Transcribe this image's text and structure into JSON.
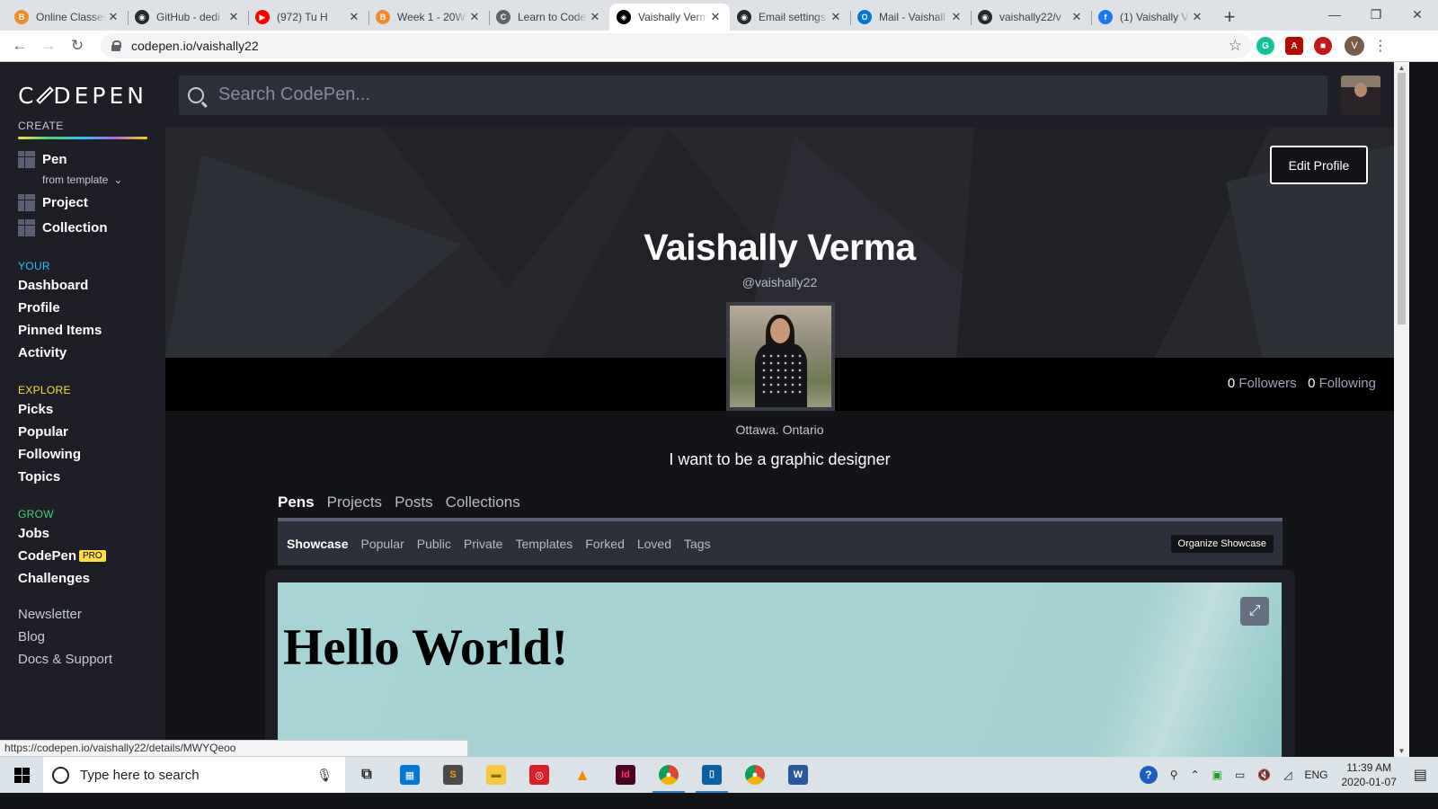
{
  "browser": {
    "tabs": [
      {
        "title": "Online Classes",
        "icon_color": "#f28c28",
        "icon_glyph": "B",
        "active": false
      },
      {
        "title": "GitHub - dedi",
        "icon_color": "#24292e",
        "icon_glyph": "◉",
        "active": false
      },
      {
        "title": "(972) Tu H",
        "icon_color": "#ff0000",
        "icon_glyph": "▶",
        "active": false
      },
      {
        "title": "Week 1 - 20W",
        "icon_color": "#f28c28",
        "icon_glyph": "B",
        "active": false
      },
      {
        "title": "Learn to Code",
        "icon_color": "#5f6368",
        "icon_glyph": "C",
        "active": false
      },
      {
        "title": "Vaishally Verm",
        "icon_color": "#000000",
        "icon_glyph": "◈",
        "active": true
      },
      {
        "title": "Email settings",
        "icon_color": "#24292e",
        "icon_glyph": "◉",
        "active": false
      },
      {
        "title": "Mail - Vaishall",
        "icon_color": "#0078d4",
        "icon_glyph": "O",
        "active": false
      },
      {
        "title": "vaishally22/v",
        "icon_color": "#24292e",
        "icon_glyph": "◉",
        "active": false
      },
      {
        "title": "(1) Vaishally V",
        "icon_color": "#1877f2",
        "icon_glyph": "f",
        "active": false
      }
    ],
    "url": "codepen.io/vaishally22",
    "profile_initial": "V",
    "status_url": "https://codepen.io/vaishally22/details/MWYQeoo"
  },
  "sidebar": {
    "logo": "CODEPEN",
    "create_label": "CREATE",
    "create_items": [
      "Pen",
      "Project",
      "Collection"
    ],
    "from_template": "from template",
    "your_label": "YOUR",
    "your_items": [
      "Dashboard",
      "Profile",
      "Pinned Items",
      "Activity"
    ],
    "explore_label": "EXPLORE",
    "explore_items": [
      "Picks",
      "Popular",
      "Following",
      "Topics"
    ],
    "grow_label": "GROW",
    "grow_items": [
      "Jobs",
      "CodePen",
      "Challenges"
    ],
    "pro_badge": "PRO",
    "misc_items": [
      "Newsletter",
      "Blog",
      "Docs & Support"
    ]
  },
  "header": {
    "search_placeholder": "Search CodePen..."
  },
  "profile": {
    "edit_button": "Edit Profile",
    "name": "Vaishally Verma",
    "handle": "@vaishally22",
    "followers_count": "0",
    "followers_label": "Followers",
    "following_count": "0",
    "following_label": "Following",
    "location": "Ottawa. Ontario",
    "bio": "I want to be a graphic designer"
  },
  "content_tabs": [
    "Pens",
    "Projects",
    "Posts",
    "Collections"
  ],
  "filter_tabs": [
    "Showcase",
    "Popular",
    "Public",
    "Private",
    "Templates",
    "Forked",
    "Loved",
    "Tags"
  ],
  "organize_button": "Organize Showcase",
  "preview": {
    "heading": "Hello World!"
  },
  "taskbar": {
    "search_placeholder": "Type here to search",
    "language": "ENG",
    "time": "11:39 AM",
    "date": "2020-01-07"
  }
}
